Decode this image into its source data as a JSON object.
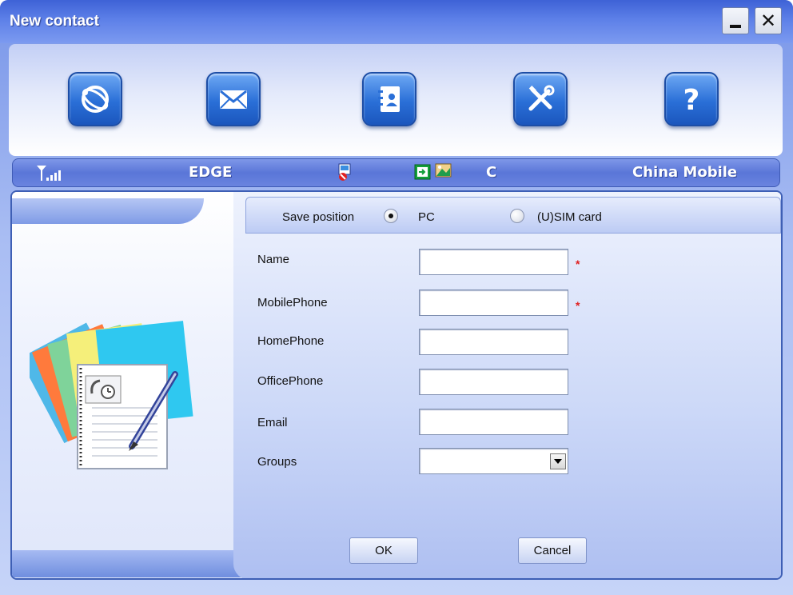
{
  "window": {
    "title": "New contact",
    "minimize_label": "_",
    "close_label": "✕"
  },
  "toolbar": {
    "items": [
      {
        "icon": "globe-connect-icon"
      },
      {
        "icon": "envelope-icon"
      },
      {
        "icon": "contacts-book-icon"
      },
      {
        "icon": "tools-icon"
      },
      {
        "icon": "help-icon"
      }
    ]
  },
  "status": {
    "signal_icon": "signal-strength-icon",
    "network_type": "EDGE",
    "sim_icon": "sim-status-icon",
    "sms_icon": "sms-icon",
    "image_icon": "picture-icon",
    "connection_letter": "C",
    "operator": "China Mobile"
  },
  "form": {
    "save_position_label": "Save position",
    "options": [
      {
        "label": "PC",
        "checked": true
      },
      {
        "label": "(U)SIM card",
        "checked": false
      }
    ],
    "fields": [
      {
        "label": "Name",
        "value": "",
        "required": true
      },
      {
        "label": "MobilePhone",
        "value": "",
        "required": true
      },
      {
        "label": "HomePhone",
        "value": "",
        "required": false
      },
      {
        "label": "OfficePhone",
        "value": "",
        "required": false
      },
      {
        "label": "Email",
        "value": "",
        "required": false
      },
      {
        "label": "Groups",
        "value": "",
        "type": "select"
      }
    ],
    "required_mark": "*",
    "ok_label": "OK",
    "cancel_label": "Cancel"
  },
  "colors": {
    "title_bar": "#3e62d6",
    "status_bar": "#5a76d8",
    "required": "#e02020"
  }
}
